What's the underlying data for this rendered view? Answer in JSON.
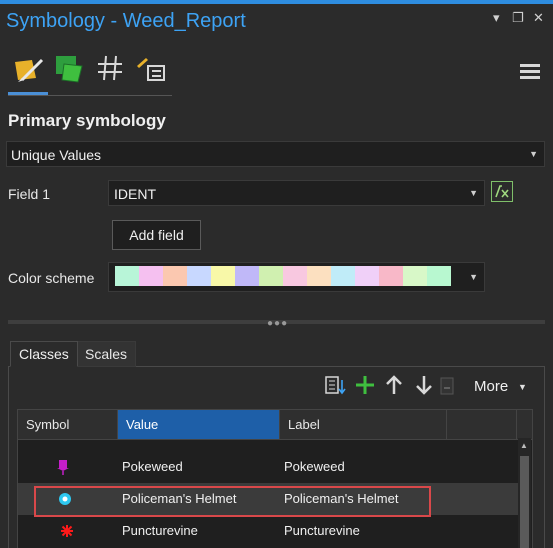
{
  "window": {
    "title": "Symbology - Weed_Report",
    "controls": [
      "▾",
      "❐",
      "✕"
    ]
  },
  "toolbar": {
    "icons": [
      "primary-symbology-icon",
      "vary-symbology-icon",
      "symbol-layers-icon",
      "label-classes-icon"
    ],
    "menu_icon": "hamburger-icon"
  },
  "primary": {
    "heading": "Primary symbology",
    "renderer": "Unique Values",
    "field1_label": "Field 1",
    "field1_value": "IDENT",
    "add_field_label": "Add field",
    "color_scheme_label": "Color scheme",
    "color_scheme_colors": [
      "#b8f5d8",
      "#f5c0f0",
      "#fbc8b0",
      "#c8d8ff",
      "#f8f8a8",
      "#c0b8f8",
      "#d0f0b0",
      "#f8c8e0",
      "#fce0c0",
      "#c0ecf8",
      "#f0d0f8",
      "#f8b8c8",
      "#d8f8c8",
      "#b8f8d0"
    ]
  },
  "tabs": [
    {
      "label": "Classes",
      "active": true
    },
    {
      "label": "Scales",
      "active": false
    }
  ],
  "classes_toolbar": {
    "more_label": "More"
  },
  "grid": {
    "columns": [
      "Symbol",
      "Value",
      "Label"
    ],
    "rows": [
      {
        "symbol": "pushpin-purple",
        "value": "Pokeweed",
        "label": "Pokeweed"
      },
      {
        "symbol": "circle-cyan",
        "value": "Policeman's Helmet",
        "label": "Policeman's Helmet"
      },
      {
        "symbol": "asterisk-red",
        "value": "Puncturevine",
        "label": "Puncturevine"
      }
    ]
  },
  "colors": {
    "accent": "#3da3f5",
    "selected_header": "#1e5fa8",
    "highlight": "#d9484a",
    "add_green": "#3fbf3f"
  }
}
